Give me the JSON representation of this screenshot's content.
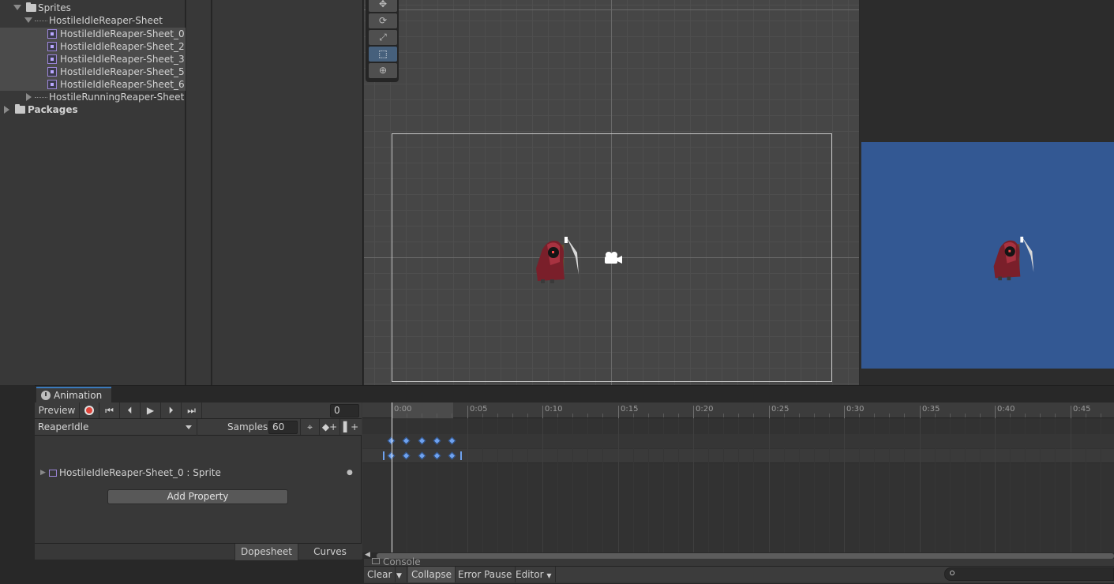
{
  "project": {
    "tree": [
      {
        "label": "Sprites",
        "type": "folder",
        "expanded": true
      },
      {
        "label": "HostileIdleReaper-Sheet",
        "type": "sheet",
        "expanded": true
      },
      {
        "label": "HostileIdleReaper-Sheet_0",
        "type": "sprite",
        "selected": true
      },
      {
        "label": "HostileIdleReaper-Sheet_2",
        "type": "sprite",
        "selected": true
      },
      {
        "label": "HostileIdleReaper-Sheet_3",
        "type": "sprite",
        "selected": true
      },
      {
        "label": "HostileIdleReaper-Sheet_5",
        "type": "sprite",
        "selected": true
      },
      {
        "label": "HostileIdleReaper-Sheet_6",
        "type": "sprite",
        "selected": true
      },
      {
        "label": "HostileRunningReaper-Sheet",
        "type": "sheet",
        "expanded": false
      },
      {
        "label": "Packages",
        "type": "folder",
        "expanded": false
      }
    ]
  },
  "scene": {
    "tools": [
      "move-icon",
      "rotate-icon",
      "scale-icon",
      "rect-icon",
      "transform-icon"
    ],
    "active_tool": "rect-icon"
  },
  "game": {
    "background_color": "#335893"
  },
  "animation": {
    "tab_label": "Animation",
    "preview_label": "Preview",
    "frame_value": "0",
    "clip_name": "ReaperIdle",
    "samples_label": "Samples",
    "samples_value": "60",
    "property_label": "HostileIdleReaper-Sheet_0 : Sprite",
    "add_property_label": "Add Property",
    "dopesheet_label": "Dopesheet",
    "curves_label": "Curves",
    "ruler_labels": [
      "0:00",
      "0:05",
      "0:10",
      "0:15",
      "0:20",
      "0:25",
      "0:30",
      "0:35",
      "0:40",
      "0:45"
    ],
    "keyframes": [
      0,
      1,
      2,
      3,
      4
    ]
  },
  "console": {
    "tab_label": "Console",
    "clear_label": "Clear",
    "collapse_label": "Collapse",
    "error_pause_label": "Error Pause",
    "editor_label": "Editor"
  },
  "colors": {
    "accent": "#3a79bb",
    "keyframe": "#6fa2ee",
    "record": "#e0443a"
  }
}
